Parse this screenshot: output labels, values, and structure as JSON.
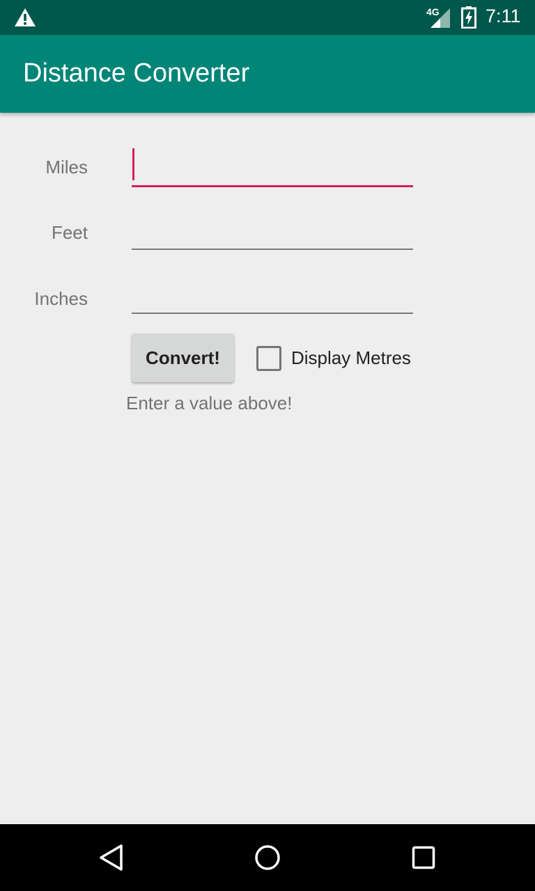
{
  "status_bar": {
    "network": "4G",
    "time": "7:11",
    "icons": [
      "warning-icon",
      "signal-icon",
      "battery-charging-icon"
    ]
  },
  "app_bar": {
    "title": "Distance Converter"
  },
  "form": {
    "fields": [
      {
        "label": "Miles",
        "value": "",
        "placeholder": "",
        "focused": true
      },
      {
        "label": "Feet",
        "value": "",
        "placeholder": ""
      },
      {
        "label": "Inches",
        "value": "",
        "placeholder": ""
      }
    ],
    "convert_label": "Convert!",
    "checkbox_label": "Display Metres",
    "checkbox_checked": false,
    "result_text": "Enter a value above!"
  },
  "nav_bar": {
    "icons": [
      "back-icon",
      "home-icon",
      "recents-icon"
    ]
  },
  "colors": {
    "status_bar": "#00574b",
    "app_bar": "#008577",
    "accent": "#d81b60",
    "background": "#eeeeee"
  }
}
